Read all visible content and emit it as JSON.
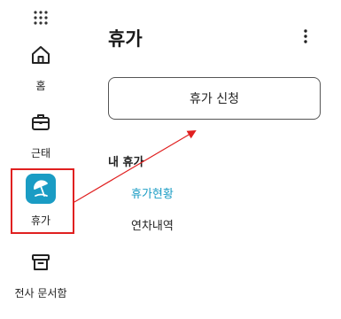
{
  "sidebar": {
    "items": [
      {
        "label": "홈",
        "icon": "home-icon"
      },
      {
        "label": "근태",
        "icon": "briefcase-icon"
      },
      {
        "label": "휴가",
        "icon": "beach-umbrella-icon",
        "selected": true
      },
      {
        "label": "전사 문서함",
        "icon": "archive-box-icon"
      }
    ]
  },
  "main": {
    "title": "휴가",
    "apply_button_label": "휴가 신청",
    "section_title": "내 휴가",
    "sub_items": [
      {
        "label": "휴가현황",
        "active": true
      },
      {
        "label": "연차내역",
        "active": false
      }
    ]
  },
  "colors": {
    "accent": "#1a9cc4",
    "annotation": "#e02020",
    "text": "#222222"
  }
}
